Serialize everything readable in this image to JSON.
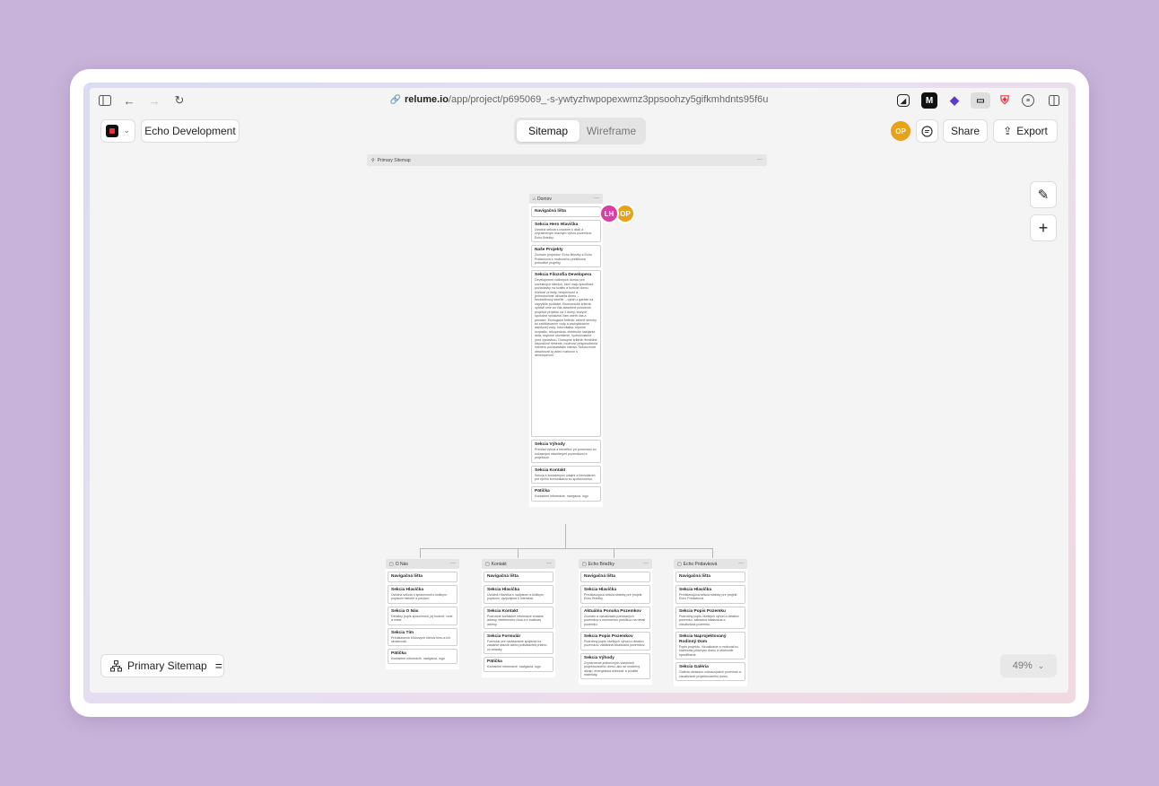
{
  "browser": {
    "url_domain": "relume.io",
    "url_path": "/app/project/p695069_-s-ywtyzhwpopexwmz3ppsoohzy5gifkmhdnts95f6u"
  },
  "header": {
    "project_name": "Echo Development",
    "tabs": [
      {
        "label": "Sitemap",
        "active": true
      },
      {
        "label": "Wireframe",
        "active": false
      }
    ],
    "user_initials": "OP",
    "share_label": "Share",
    "export_label": "Export"
  },
  "canvas": {
    "sitemap_title": "Primary Sitemap",
    "hover_users": [
      "LH",
      "OP"
    ],
    "root": {
      "title": "Domov",
      "sections": [
        {
          "title": "Navigačná lišta",
          "desc": ""
        },
        {
          "title": "Sekcia Hero Hlavička",
          "desc": "Úvodná sekcia s úvodom k akcii a zvýrazneným hlavným výhod pozemkov Echo Briežky."
        },
        {
          "title": "Naše Projekty",
          "desc": "Zoznam projektov: Echo Briežky a Echo Pridavková s možnosťou preklikuna jednotlivé projekty."
        },
        {
          "title": "Sekcia Filozofia Developera",
          "desc": "Development rodinných domov pre súvestných klientov, ktorí majú špecifické požiadavky na kvalitu a funkcie domu: blízkosť prírody, bezpečnosť a jednoduchosť užívania domu – bezbariérový interiér – výťah z garáže na najvyššie podlažie. Ekonomické kritériá: vybavil sme sa Vás stavebné povolenie, projekcií projektu na 3 domy, ktorých spoločné výstavba Vám ušetrí čas a peniaze. Ekologické kritériá: zelené strechy so zadržiavaním vody a zachytávaním dažďovej vody, fotovoltaika, tepelné čerpadlo, rekuperácia, elektrické nabíjanie auta, úsporné osvetlenie, hydroizolačné pred výstavbou. Dostupné kritériá: flexibilné dispozičné riešenie, možnosť prispôsobenia interiéru požiadavkám klienta. Sekcia bude obsahovať aj video rozhovor s developerom."
        },
        {
          "title": "Sekcia Výhody",
          "desc": "Prehľad výhod a benefitov pri porovnaní so súčasnými stavebnými pozemkami a projektom."
        },
        {
          "title": "Sekcia Kontakt",
          "desc": "Sekcia s kontaktnými údajmi a formulárom pre rýchlu komunikáciu so spoločnosťou."
        },
        {
          "title": "Pätička",
          "desc": "Kontaktné informácie, navigácia, logo"
        }
      ]
    },
    "children": [
      {
        "title": "O Nás",
        "sections": [
          {
            "title": "Navigačná lišta",
            "desc": ""
          },
          {
            "title": "Sekcia Hlavička",
            "desc": "Úvodná sekcia o spoločnosti s krátkym popisom histórie a poslaní."
          },
          {
            "title": "Sekcia O Nás",
            "desc": "Detailný popis spoločnosti, jej hodnôt, vízie a misie."
          },
          {
            "title": "Sekcia Tím",
            "desc": "Predstavenie kľúčových členov tímu a ich skúseností."
          },
          {
            "title": "Pätička",
            "desc": "Kontaktné informácie, navigácia, logo"
          }
        ]
      },
      {
        "title": "Kontakt",
        "sections": [
          {
            "title": "Navigačná lišta",
            "desc": ""
          },
          {
            "title": "Sekcia Hlavička",
            "desc": "Úvodná Hlavička s nadpisom a krátkym popisom, vyzývajúca k interakcii."
          },
          {
            "title": "Sekcia Kontakt",
            "desc": "Podrobné kontaktné informácie vrátane adresy, telefónneho čísla a e-mailovej adresy."
          },
          {
            "title": "Sekcia Formulár",
            "desc": "Formulár pre nadviazanie spojenia na zaslanie otázok alebo požiadaviek priamo zo stránky."
          },
          {
            "title": "Pätička",
            "desc": "Kontaktné informácie, navigácia, logo"
          }
        ]
      },
      {
        "title": "Echo Briežky",
        "sections": [
          {
            "title": "Navigačná lišta",
            "desc": ""
          },
          {
            "title": "Sekcia Hlavička",
            "desc": "Predstavujúca sekcia stránky pre projekt Echo Briežky."
          },
          {
            "title": "Aktuálna Ponuka Pozemkov",
            "desc": "Zoznam a vizualizácia ponúkaných pozemkov s možnosťou preklikou na detail pozemku."
          },
          {
            "title": "Sekcia Popis Pozemkov",
            "desc": "Podrobný popis všetkých výhod a detailov pozemkov, základná lokalizácia pozemkov."
          },
          {
            "title": "Sekcia Výhody",
            "desc": "Zvýraznenie jedinečných vlastností projektovaného domu, ako sú moderný dizajn, energetická účinnosť a použité materiály."
          }
        ]
      },
      {
        "title": "Echo Pridavková",
        "sections": [
          {
            "title": "Navigačná lišta",
            "desc": ""
          },
          {
            "title": "Sekcia Hlavička",
            "desc": "Predstavujúca sekcia stránky pre projekt Echo Pridavková."
          },
          {
            "title": "Sekcia Popis Pozemku",
            "desc": "Podrobný popis všetkých výhod a detailov pozemku, základná lokalizácia a vizualizácia pozemku."
          },
          {
            "title": "Sekcia Naprojektovaný Rodinný Dom",
            "desc": "Popis projektu. Vizualizácie a možnosťou stiahnutia pôdorysu domu a stiahnutie špecifikácie."
          },
          {
            "title": "Sekcia Galéria",
            "desc": "Galéria obrázkov zobrazujúcich pozemok a vizualizácie projektovaného domu."
          }
        ]
      }
    ]
  },
  "footer": {
    "sitemap_selector": "Primary Sitemap",
    "zoom": "49%"
  }
}
